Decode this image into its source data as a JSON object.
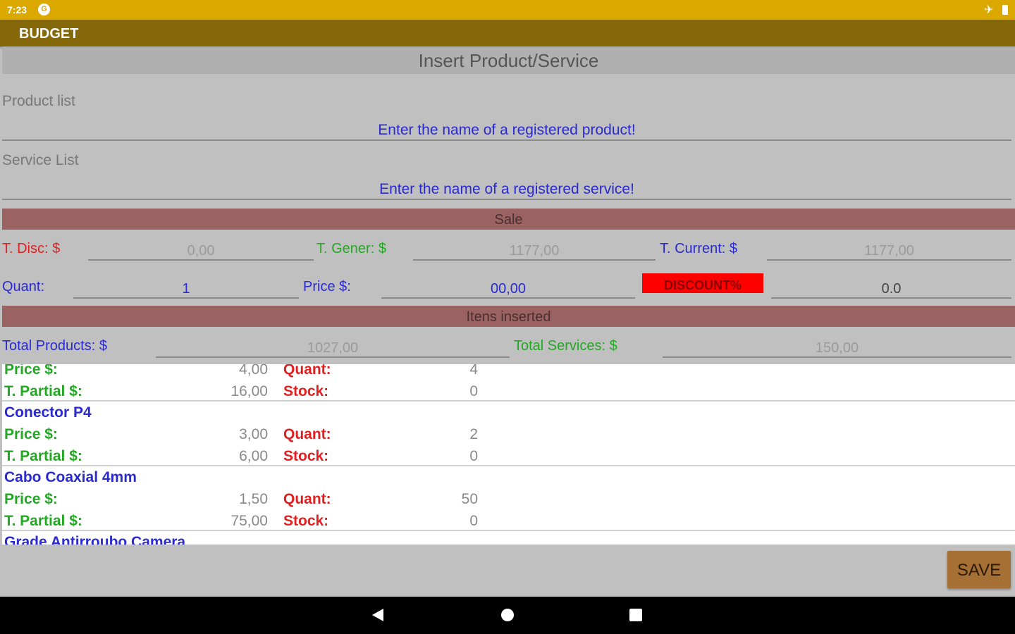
{
  "status": {
    "time": "7:23"
  },
  "app": {
    "title": "BUDGET"
  },
  "header": {
    "title": "Insert Product/Service"
  },
  "product": {
    "label": "Product list",
    "placeholder": "Enter the name of a registered product!"
  },
  "service": {
    "label": "Service List",
    "placeholder": "Enter the name of a registered service!"
  },
  "sale": {
    "title": "Sale",
    "t_disc_label": "T. Disc: $",
    "t_disc_value": "0,00",
    "t_gener_label": "T. Gener: $",
    "t_gener_value": "1177,00",
    "t_current_label": "T. Current: $",
    "t_current_value": "1177,00",
    "quant_label": "Quant:",
    "quant_value": "1",
    "price_label": "Price $:",
    "price_value": "00,00",
    "discount_label": "DISCOUNT%",
    "discount_value": "0.0"
  },
  "itens": {
    "title": "Itens inserted",
    "total_products_label": "Total Products: $",
    "total_products_value": "1027,00",
    "total_services_label": "Total Services: $",
    "total_services_value": "150,00"
  },
  "list_labels": {
    "price": "Price $:",
    "partial": "T. Partial $:",
    "quant": "Quant:",
    "stock": "Stock:"
  },
  "items": [
    {
      "name": "",
      "price": "4,00",
      "quant": "4",
      "partial": "16,00",
      "stock": "0"
    },
    {
      "name": "Conector P4",
      "price": "3,00",
      "quant": "2",
      "partial": "6,00",
      "stock": "0"
    },
    {
      "name": "Cabo Coaxial 4mm",
      "price": "1,50",
      "quant": "50",
      "partial": "75,00",
      "stock": "0"
    },
    {
      "name": "Grade Antirroubo Camera",
      "price": "",
      "quant": "",
      "partial": "",
      "stock": ""
    }
  ],
  "actions": {
    "save": "SAVE"
  },
  "colors": {
    "status_bar": "#dba800",
    "app_bar": "#856809",
    "band": "#9b6262",
    "discount": "#ff0000",
    "save": "#a66f34"
  }
}
